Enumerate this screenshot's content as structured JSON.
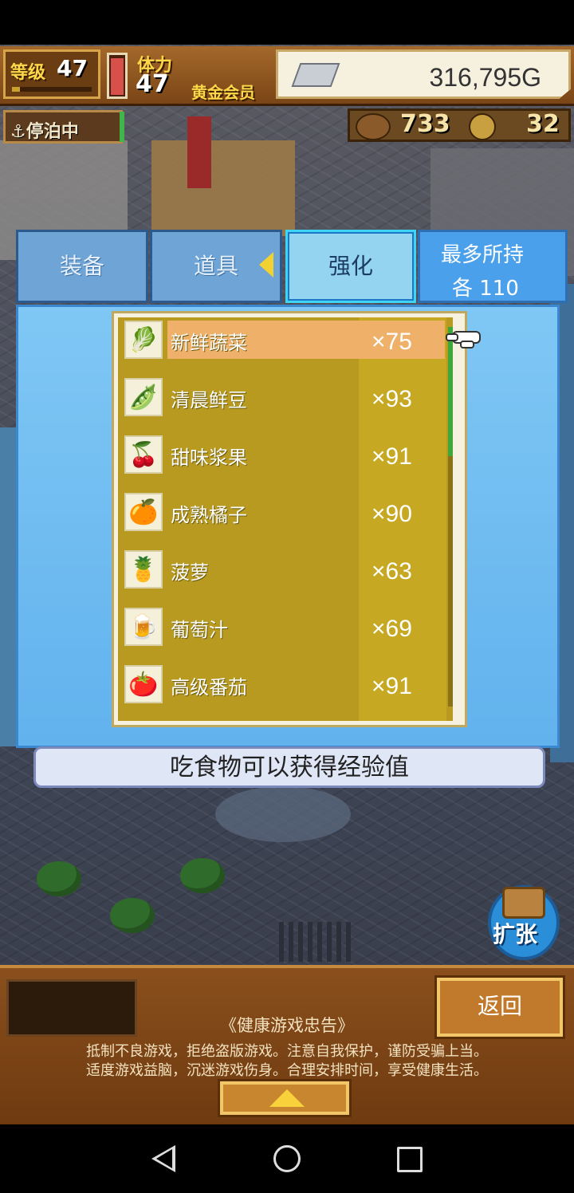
{
  "hud": {
    "level_label": "等级",
    "level_value": "47",
    "level_exp_fraction": 0.1,
    "stamina_label": "体力",
    "stamina_value": "47",
    "stamina_fill_fraction": 0.95,
    "membership": "黄金会员",
    "money": "316,795G",
    "status": "停泊中",
    "resource_a": "733",
    "resource_b": "32"
  },
  "tabs": [
    {
      "label": "装备"
    },
    {
      "label": "道具"
    },
    {
      "label": "强化"
    }
  ],
  "max_hold": {
    "line1": "最多所持",
    "line2": "各 110"
  },
  "items": [
    {
      "name": "新鲜蔬菜",
      "qty": "×75",
      "icon": "vegetable-icon",
      "glyph": "🥬"
    },
    {
      "name": "清晨鲜豆",
      "qty": "×93",
      "icon": "bean-icon",
      "glyph": "🫛"
    },
    {
      "name": "甜味浆果",
      "qty": "×91",
      "icon": "berry-icon",
      "glyph": "🍒"
    },
    {
      "name": "成熟橘子",
      "qty": "×90",
      "icon": "orange-icon",
      "glyph": "🍊"
    },
    {
      "name": "菠萝",
      "qty": "×63",
      "icon": "pineapple-icon",
      "glyph": "🍍"
    },
    {
      "name": "葡萄汁",
      "qty": "×69",
      "icon": "juice-icon",
      "glyph": "🍺"
    },
    {
      "name": "高级番茄",
      "qty": "×91",
      "icon": "tomato-icon",
      "glyph": "🍅"
    }
  ],
  "hint": "吃食物可以获得经验值",
  "expand_label": "扩张",
  "back_label": "返回",
  "notice": {
    "title": "《健康游戏忠告》",
    "line1": "抵制不良游戏，拒绝盗版游戏。注意自我保护，谨防受骗上当。",
    "line2": "适度游戏益脑，沉迷游戏伤身。合理安排时间，享受健康生活。"
  },
  "colors": {
    "panel_blue": "#62b2ee",
    "list_gold": "#b79a1f",
    "selected_row": "#efb06a",
    "wood": "#8a4f1c"
  }
}
